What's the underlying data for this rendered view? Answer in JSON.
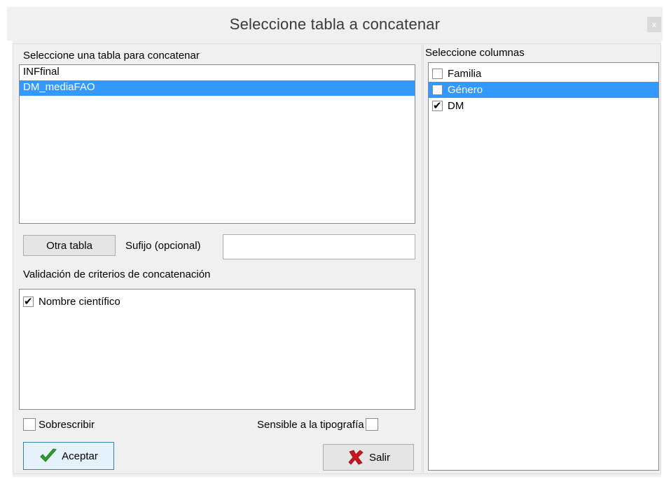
{
  "window": {
    "title": "Seleccione tabla a concatenar",
    "close_label": "x"
  },
  "left": {
    "tables_label": "Seleccione una tabla para concatenar",
    "tables": [
      {
        "label": "INFfinal",
        "selected": false
      },
      {
        "label": "DM_mediaFAO",
        "selected": true
      }
    ],
    "other_table_button": "Otra tabla",
    "suffix_label": "Sufijo (opcional)",
    "suffix_value": "",
    "criteria_label": "Validación de criterios de concatenación",
    "criteria": [
      {
        "label": "Nombre científico",
        "checked": true
      }
    ],
    "overwrite_label": "Sobrescribir",
    "overwrite_checked": false,
    "case_sensitive_label": "Sensible a la tipografía",
    "case_sensitive_checked": false,
    "accept_button": "Aceptar",
    "exit_button": "Salir"
  },
  "right": {
    "columns_label": "Seleccione columnas",
    "columns": [
      {
        "label": "Familia",
        "checked": false,
        "selected": false
      },
      {
        "label": "Género",
        "checked": false,
        "selected": true
      },
      {
        "label": "DM",
        "checked": true,
        "selected": false
      }
    ]
  },
  "colors": {
    "selection": "#3399ff",
    "accept_icon": "#2e9e2e",
    "exit_icon": "#c8161d"
  },
  "icons": {
    "accept": "checkmark-icon",
    "exit": "x-mark-icon",
    "close": "close-icon"
  }
}
